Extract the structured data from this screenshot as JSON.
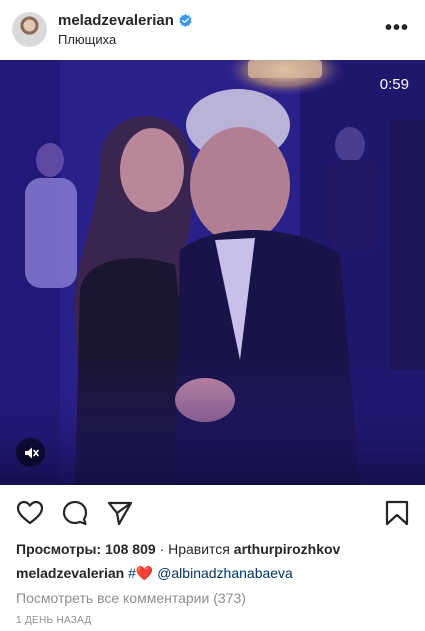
{
  "post": {
    "username": "meladzevalerian",
    "location": "Плющиха",
    "more_label": "•••",
    "video_duration": "0:59",
    "views_label": "Просмотры:",
    "views_count": "108 809",
    "liked_by_prefix": "· Нравится",
    "liked_by_user": "arthurpirozhkov",
    "caption_user": "meladzevalerian",
    "caption_hash": "#",
    "caption_heart": "❤️",
    "caption_mention": "@albinadzhanabaeva",
    "view_all_comments": "Посмотреть все комментарии (373)",
    "timestamp": "1 ДЕНЬ НАЗАД"
  },
  "icons": {
    "avatar": "avatar",
    "verified": "verified-badge-icon",
    "like": "heart-outline-icon",
    "comment": "comment-bubble-icon",
    "share": "paper-plane-icon",
    "save": "bookmark-icon",
    "mute": "muted-speaker-icon"
  },
  "colors": {
    "verified": "#3897f0",
    "mention": "#003569",
    "heart": "#ed4956",
    "secondary_text": "#8e8e8e"
  }
}
